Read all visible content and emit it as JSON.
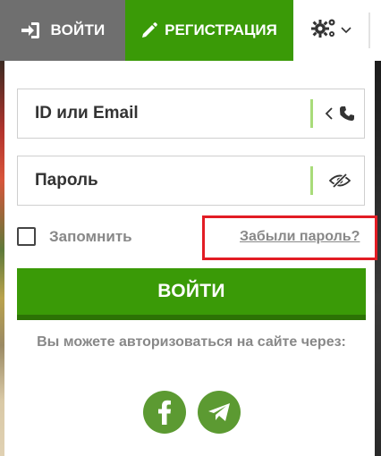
{
  "header": {
    "login_label": "ВОЙТИ",
    "register_label": "РЕГИСТРАЦИЯ"
  },
  "form": {
    "id_placeholder": "ID или Email",
    "password_placeholder": "Пароль",
    "remember_label": "Запомнить",
    "forgot_label": "Забыли пароль?",
    "submit_label": "ВОЙТИ",
    "social_note": "Вы можете авторизоваться на сайте через:"
  },
  "icons": {
    "login": "sign-in-icon",
    "register": "pencil-icon",
    "settings": "gears-icon",
    "dropdown": "chevron-down-icon",
    "id_toggle": "chevron-left-icon",
    "phone": "phone-icon",
    "password_toggle": "eye-slash-icon",
    "facebook": "facebook-icon",
    "telegram": "telegram-icon"
  },
  "colors": {
    "brand_green": "#3a9a07",
    "login_gray": "#6f6f6f",
    "highlight_red": "#e21c24",
    "social_green": "#5c9a32"
  }
}
